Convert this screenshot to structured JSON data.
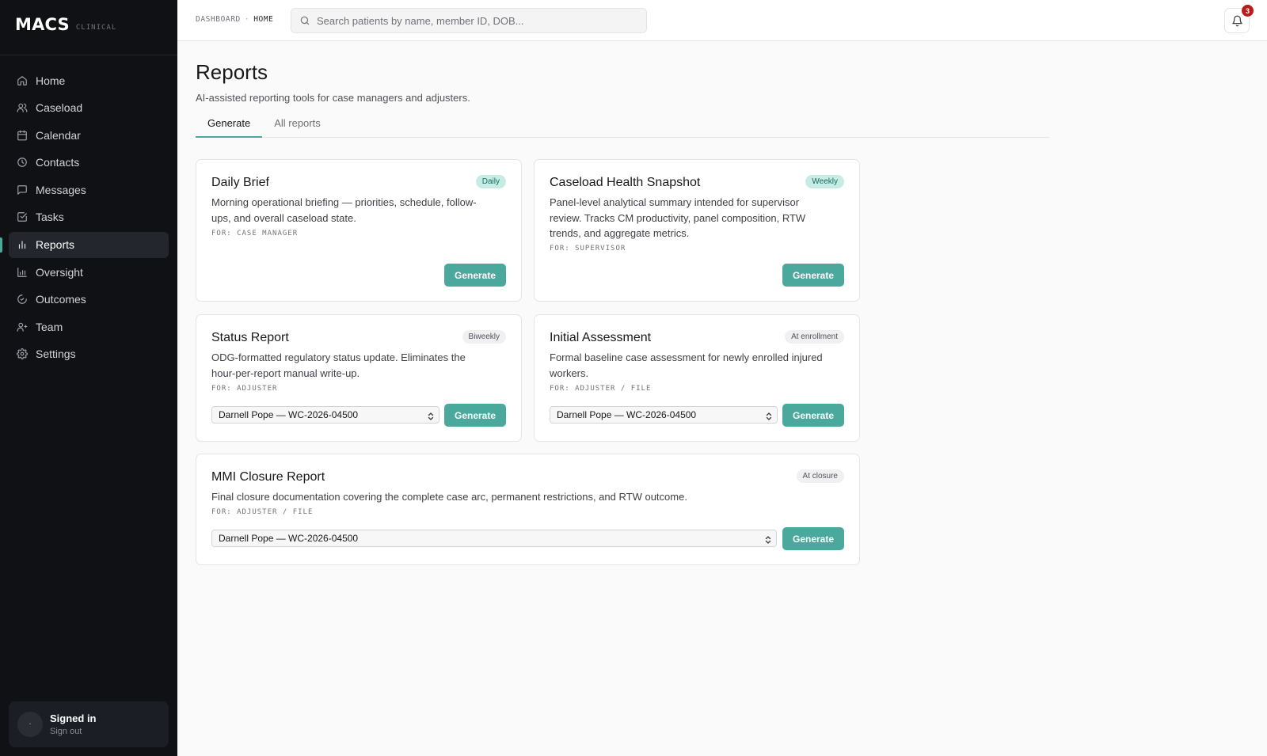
{
  "brand": {
    "name": "MACS",
    "sub": "CLINICAL"
  },
  "sidebar": {
    "items": [
      {
        "label": "Home",
        "icon": "home-icon"
      },
      {
        "label": "Caseload",
        "icon": "users-icon"
      },
      {
        "label": "Calendar",
        "icon": "calendar-icon"
      },
      {
        "label": "Contacts",
        "icon": "clock-icon"
      },
      {
        "label": "Messages",
        "icon": "message-icon"
      },
      {
        "label": "Tasks",
        "icon": "checkbox-icon"
      },
      {
        "label": "Reports",
        "icon": "bar-chart-icon",
        "active": true
      },
      {
        "label": "Oversight",
        "icon": "chart-icon"
      },
      {
        "label": "Outcomes",
        "icon": "gauge-icon"
      },
      {
        "label": "Team",
        "icon": "team-icon"
      },
      {
        "label": "Settings",
        "icon": "gear-icon"
      }
    ]
  },
  "user": {
    "avatar": "·",
    "signed_in": "Signed in",
    "sign_out": "Sign out"
  },
  "topbar": {
    "breadcrumb": [
      "DASHBOARD",
      "HOME"
    ],
    "search_placeholder": "Search patients by name, member ID, DOB...",
    "notifications": "3"
  },
  "page": {
    "title": "Reports",
    "subtitle": "AI-assisted reporting tools for case managers and adjusters.",
    "tabs": [
      "Generate",
      "All reports"
    ]
  },
  "cards": [
    {
      "title": "Daily Brief",
      "frequency": "Daily",
      "desc1": "Morning operational briefing — priorities, schedule, follow-",
      "desc2": "ups, and overall caseload state.",
      "for": "FOR: CASE MANAGER",
      "button": "Generate"
    },
    {
      "title": "Caseload Health Snapshot",
      "frequency": "Weekly",
      "desc1": "Panel-level analytical summary intended for supervisor",
      "desc2": "review. Tracks CM productivity, panel composition, RTW",
      "desc3": "trends, and aggregate metrics.",
      "for": "FOR: SUPERVISOR",
      "button": "Generate"
    },
    {
      "title": "Status Report",
      "frequency": "Biweekly",
      "desc1": "ODG-formatted regulatory status update. Eliminates the",
      "desc2": "hour-per-report manual write-up.",
      "for": "FOR: ADJUSTER",
      "select": "Darnell Pope — WC-2026-04500",
      "button": "Generate"
    },
    {
      "title": "Initial Assessment",
      "frequency": "At enrollment",
      "desc1": "Formal baseline case assessment for newly enrolled injured",
      "desc2": "workers.",
      "for": "FOR: ADJUSTER / FILE",
      "select": "Darnell Pope — WC-2026-04500",
      "button": "Generate"
    },
    {
      "title": "MMI Closure Report",
      "frequency": "At closure",
      "desc1": "Final closure documentation covering the complete case arc, permanent restrictions, and RTW outcome.",
      "for": "FOR: ADJUSTER / FILE",
      "select": "Darnell Pope — WC-2026-04500",
      "button": "Generate"
    }
  ],
  "colors": {
    "accent": "#4aa89c",
    "sidebar_bg": "#0f1115",
    "badge": "#b91c1c"
  }
}
